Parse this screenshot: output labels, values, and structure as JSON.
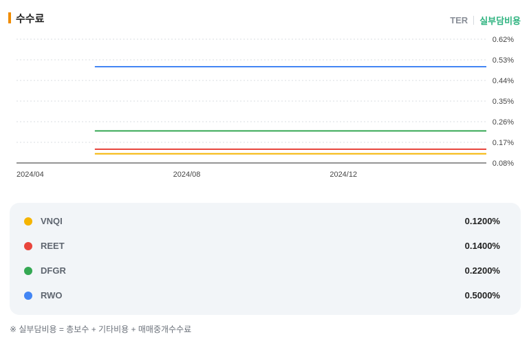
{
  "header": {
    "title": "수수료",
    "tab_ter": "TER",
    "tab_real": "실부담비용"
  },
  "chart_data": {
    "type": "line",
    "x_ticks": [
      "2024/04",
      "2024/08",
      "2024/12"
    ],
    "x_range": [
      "2024/04",
      "2025/04"
    ],
    "y_ticks": [
      "0.62%",
      "0.53%",
      "0.44%",
      "0.35%",
      "0.26%",
      "0.17%",
      "0.08%"
    ],
    "ylim": [
      0.08,
      0.62
    ],
    "grid": true,
    "series": [
      {
        "name": "VNQI",
        "color": "#f5b400",
        "x_start": "2024/06",
        "x_end": "2025/04",
        "value": 0.12
      },
      {
        "name": "REET",
        "color": "#e8453c",
        "x_start": "2024/06",
        "x_end": "2025/04",
        "value": 0.14
      },
      {
        "name": "DFGR",
        "color": "#34a853",
        "x_start": "2024/06",
        "x_end": "2025/04",
        "value": 0.22
      },
      {
        "name": "RWO",
        "color": "#4285f4",
        "x_start": "2024/06",
        "x_end": "2025/04",
        "value": 0.5
      }
    ]
  },
  "legend": [
    {
      "name": "VNQI",
      "value": "0.1200%"
    },
    {
      "name": "REET",
      "value": "0.1400%"
    },
    {
      "name": "DFGR",
      "value": "0.2200%"
    },
    {
      "name": "RWO",
      "value": "0.5000%"
    }
  ],
  "footnote": "※ 실부담비용 = 총보수 + 기타비용 + 매매중개수수료"
}
